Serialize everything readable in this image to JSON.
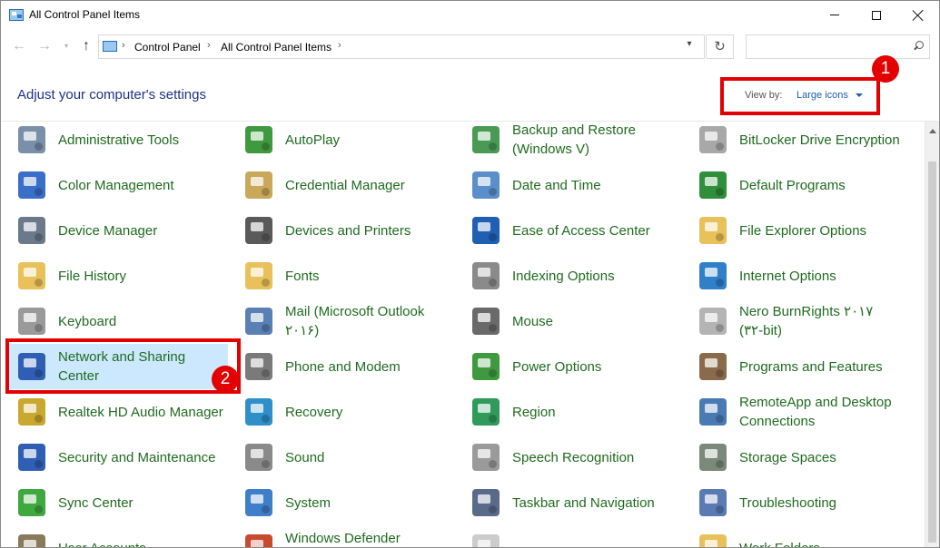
{
  "window": {
    "title": "All Control Panel Items"
  },
  "nav": {
    "back": "←",
    "forward": "→",
    "recent": "▾",
    "up": "↑",
    "breadcrumb": [
      "Control Panel",
      "All Control Panel Items"
    ],
    "separator": "›",
    "dropdown": "▾",
    "refresh": "↻",
    "search_value": ""
  },
  "header": {
    "title": "Adjust your computer's settings",
    "view_by_label": "View by:",
    "view_by_value": "Large icons"
  },
  "annotations": {
    "badge_1": "1",
    "badge_2": "2",
    "highlight_color": "#e30000"
  },
  "items": [
    {
      "label": "Administrative Tools",
      "icon": "admin-tools-icon",
      "color": "#7a8fa8"
    },
    {
      "label": "AutoPlay",
      "icon": "autoplay-icon",
      "color": "#3f9a3f"
    },
    {
      "label": "Backup and Restore\n(Windows V)",
      "icon": "backup-restore-icon",
      "color": "#4a9a55"
    },
    {
      "label": "BitLocker Drive Encryption",
      "icon": "bitlocker-icon",
      "color": "#a8a8a8"
    },
    {
      "label": "Color Management",
      "icon": "color-management-icon",
      "color": "#3a6fc9"
    },
    {
      "label": "Credential Manager",
      "icon": "credential-manager-icon",
      "color": "#c9a85a"
    },
    {
      "label": "Date and Time",
      "icon": "date-time-icon",
      "color": "#5a8fc9"
    },
    {
      "label": "Default Programs",
      "icon": "default-programs-icon",
      "color": "#2f8f3a"
    },
    {
      "label": "Device Manager",
      "icon": "device-manager-icon",
      "color": "#6a7a8a"
    },
    {
      "label": "Devices and Printers",
      "icon": "devices-printers-icon",
      "color": "#5a5a5a"
    },
    {
      "label": "Ease of Access Center",
      "icon": "ease-of-access-icon",
      "color": "#1f5fb4"
    },
    {
      "label": "File Explorer Options",
      "icon": "file-explorer-options-icon",
      "color": "#e8c15a"
    },
    {
      "label": "File History",
      "icon": "file-history-icon",
      "color": "#e8c15a"
    },
    {
      "label": "Fonts",
      "icon": "fonts-icon",
      "color": "#e8c15a"
    },
    {
      "label": "Indexing Options",
      "icon": "indexing-options-icon",
      "color": "#8a8a8a"
    },
    {
      "label": "Internet Options",
      "icon": "internet-options-icon",
      "color": "#2f7fc9"
    },
    {
      "label": "Keyboard",
      "icon": "keyboard-icon",
      "color": "#9a9a9a"
    },
    {
      "label": "Mail (Microsoft Outlook\n۲۰۱۶)",
      "icon": "mail-icon",
      "color": "#5a7fb4"
    },
    {
      "label": "Mouse",
      "icon": "mouse-icon",
      "color": "#6a6a6a"
    },
    {
      "label": "Nero BurnRights ۲۰۱۷\n(۳۲-bit)",
      "icon": "nero-burnrights-icon",
      "color": "#b4b4b4"
    },
    {
      "label": "Network and Sharing\nCenter",
      "icon": "network-sharing-icon",
      "color": "#2f5fb4",
      "selected": true
    },
    {
      "label": "Phone and Modem",
      "icon": "phone-modem-icon",
      "color": "#7a7a7a"
    },
    {
      "label": "Power Options",
      "icon": "power-options-icon",
      "color": "#3f9a3f"
    },
    {
      "label": "Programs and Features",
      "icon": "programs-features-icon",
      "color": "#8a6a4a"
    },
    {
      "label": "Realtek HD Audio Manager",
      "icon": "realtek-audio-icon",
      "color": "#c9a82f"
    },
    {
      "label": "Recovery",
      "icon": "recovery-icon",
      "color": "#2f8fc9"
    },
    {
      "label": "Region",
      "icon": "region-icon",
      "color": "#2f9a5a"
    },
    {
      "label": "RemoteApp and Desktop\nConnections",
      "icon": "remoteapp-icon",
      "color": "#4a7ab4"
    },
    {
      "label": "Security and Maintenance",
      "icon": "security-maintenance-icon",
      "color": "#2f5fb4"
    },
    {
      "label": "Sound",
      "icon": "sound-icon",
      "color": "#8a8a8a"
    },
    {
      "label": "Speech Recognition",
      "icon": "speech-recognition-icon",
      "color": "#9a9a9a"
    },
    {
      "label": "Storage Spaces",
      "icon": "storage-spaces-icon",
      "color": "#7a8a7a"
    },
    {
      "label": "Sync Center",
      "icon": "sync-center-icon",
      "color": "#3fa83f"
    },
    {
      "label": "System",
      "icon": "system-icon",
      "color": "#3f7fc9"
    },
    {
      "label": "Taskbar and Navigation",
      "icon": "taskbar-navigation-icon",
      "color": "#5a6a8a"
    },
    {
      "label": "Troubleshooting",
      "icon": "troubleshooting-icon",
      "color": "#5a7ab4"
    },
    {
      "label": "User Accounts",
      "icon": "user-accounts-icon",
      "color": "#8a7a5a"
    },
    {
      "label": "Windows Defender\nFirewall",
      "icon": "windows-defender-icon",
      "color": "#c94a2f"
    },
    {
      "label": "",
      "icon": "blank-icon",
      "color": "#cccccc"
    },
    {
      "label": "Work Folders",
      "icon": "work-folders-icon",
      "color": "#e8c15a"
    }
  ]
}
